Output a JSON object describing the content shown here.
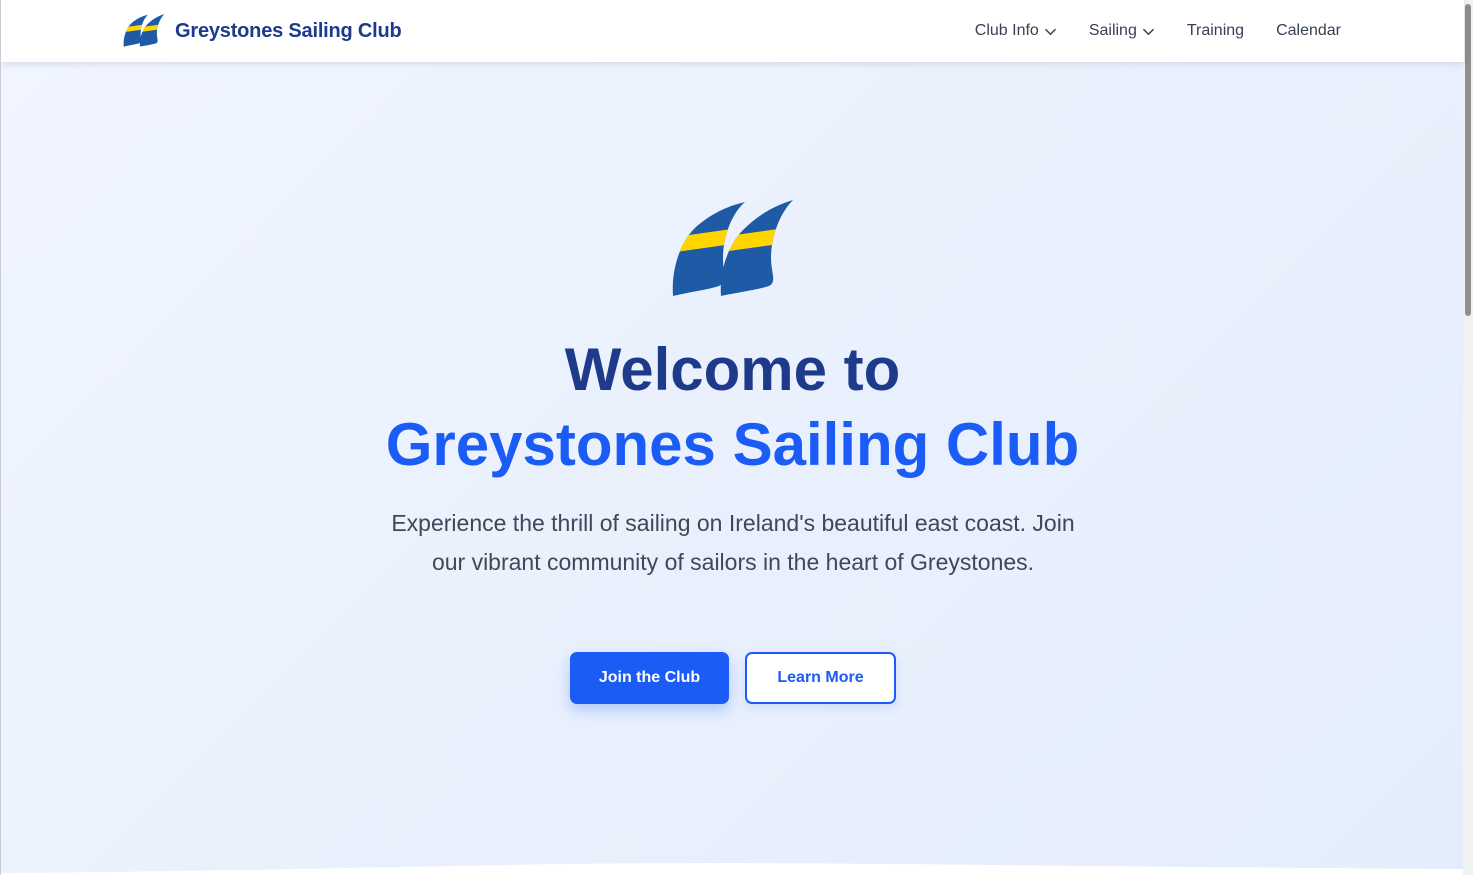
{
  "brand": {
    "name": "Greystones Sailing Club",
    "logo_icon": "sails-logo-icon"
  },
  "nav": {
    "items": [
      {
        "label": "Club Info",
        "has_dropdown": true
      },
      {
        "label": "Sailing",
        "has_dropdown": true
      },
      {
        "label": "Training",
        "has_dropdown": false
      },
      {
        "label": "Calendar",
        "has_dropdown": false
      }
    ]
  },
  "hero": {
    "title_line1": "Welcome to",
    "title_line2": "Greystones Sailing Club",
    "subtitle": "Experience the thrill of sailing on Ireland's beautiful east coast. Join our vibrant community of sailors in the heart of Greystones.",
    "primary_button": "Join the Club",
    "secondary_button": "Learn More"
  },
  "colors": {
    "navy": "#1e3a8a",
    "accent_blue": "#1a5cf5",
    "sail_blue": "#1f5aa6",
    "sail_yellow": "#ffd500",
    "hero_bg": "#eaf1fd"
  }
}
